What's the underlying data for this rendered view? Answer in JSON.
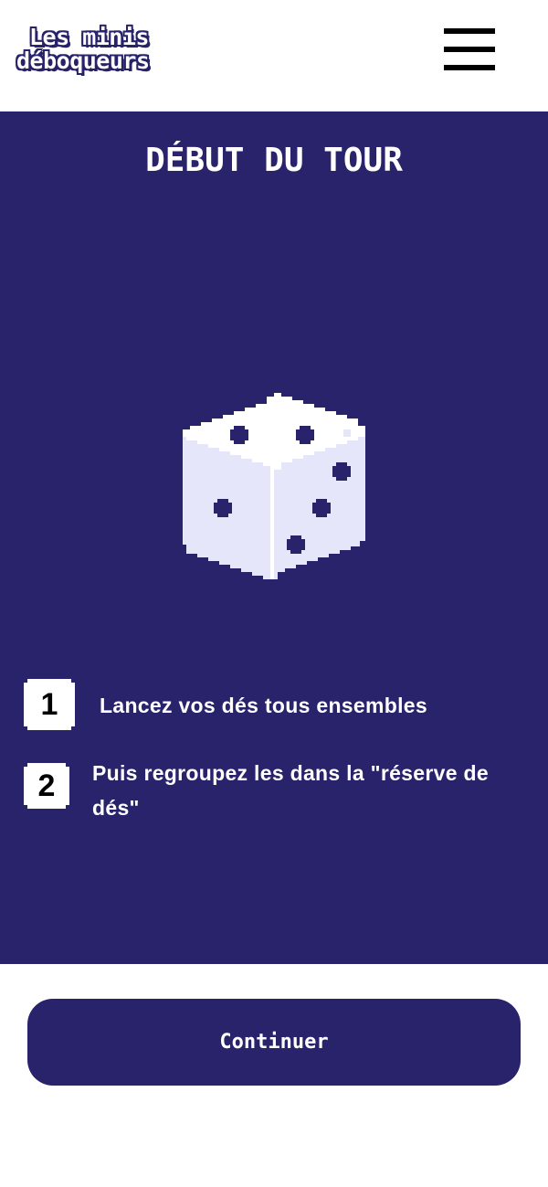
{
  "header": {
    "logo": {
      "line1": "Les minis",
      "line2": "déboqueurs"
    },
    "menu_icon": "hamburger-menu-icon"
  },
  "main": {
    "title": "DÉBUT DU TOUR",
    "illustration_icon": "dice-icon",
    "steps": [
      {
        "number": "1",
        "text": "Lancez vos dés tous ensembles"
      },
      {
        "number": "2",
        "text": "Puis regroupez les dans la \"réserve de dés\""
      }
    ]
  },
  "footer": {
    "continue_label": "Continuer"
  },
  "colors": {
    "primary": "#28236a",
    "background": "#ffffff",
    "text_light": "#ffffff",
    "dice_face": "#e6e6fa"
  }
}
